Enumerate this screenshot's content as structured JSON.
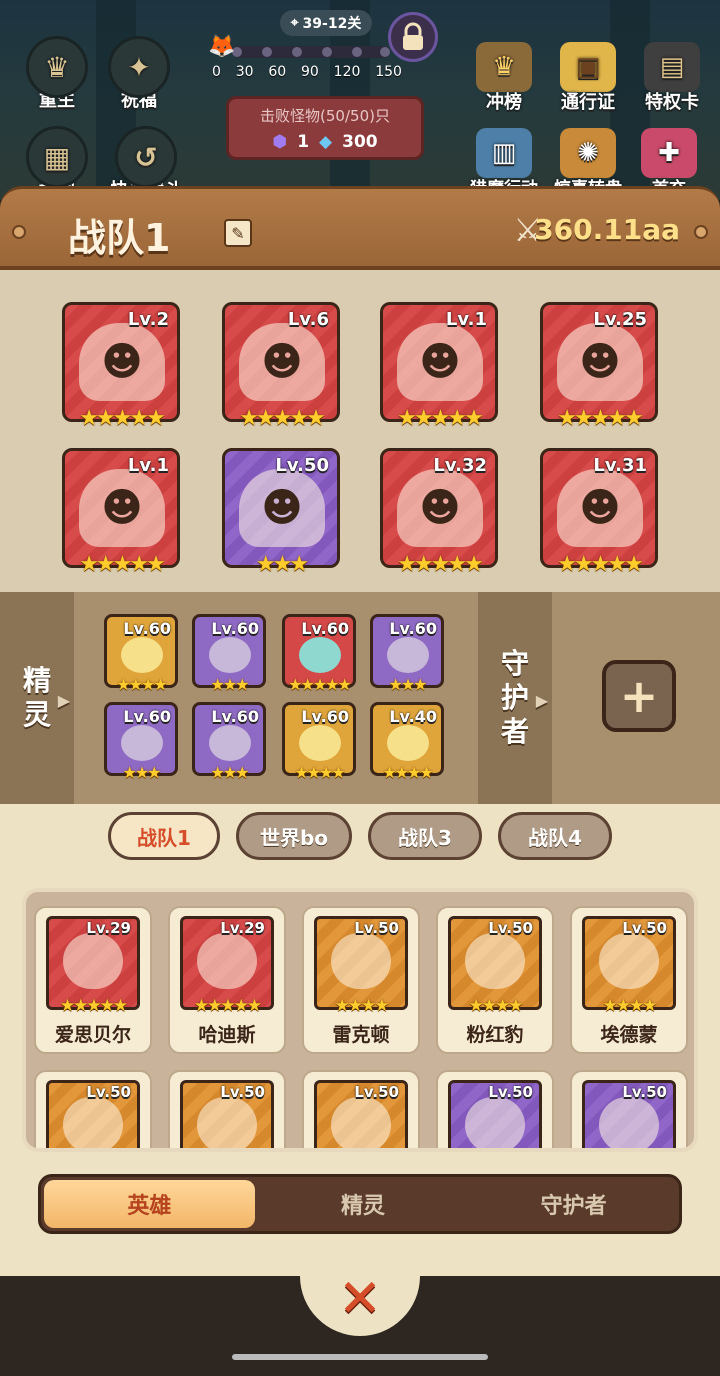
{
  "hud": {
    "stage": "39-12关",
    "progress_ticks": [
      "0",
      "30",
      "60",
      "90",
      "120",
      "150"
    ],
    "monster_label": "击败怪物(50/50)只",
    "monster_reward_gem": "1",
    "monster_reward_diamond": "300",
    "left_buttons": [
      "重生",
      "祝福",
      "地图",
      "快速战斗"
    ],
    "right_buttons": [
      "冲榜",
      "通行证",
      "特权卡"
    ],
    "bottom_right_buttons": [
      "猎魔行动",
      "惊喜转盘",
      "首充"
    ]
  },
  "team": {
    "title": "战队1",
    "power": "360.11aa"
  },
  "heroes": [
    {
      "lv": "Lv.2",
      "stars": "★★★★★",
      "color": "red"
    },
    {
      "lv": "Lv.6",
      "stars": "★★★★★",
      "color": "red"
    },
    {
      "lv": "Lv.1",
      "stars": "★★★★★",
      "color": "red"
    },
    {
      "lv": "Lv.25",
      "stars": "★★★★★",
      "color": "red"
    },
    {
      "lv": "Lv.1",
      "stars": "★★★★★",
      "color": "red"
    },
    {
      "lv": "Lv.50",
      "stars": "★★★",
      "color": "purple"
    },
    {
      "lv": "Lv.32",
      "stars": "★★★★★",
      "color": "red"
    },
    {
      "lv": "Lv.31",
      "stars": "★★★★★",
      "color": "red"
    }
  ],
  "spirit_tab": "精灵",
  "guardian_tab": "守护者",
  "spirits": [
    {
      "lv": "Lv.60",
      "stars": "★★★★",
      "color": "gold"
    },
    {
      "lv": "Lv.60",
      "stars": "★★★",
      "color": "purple"
    },
    {
      "lv": "Lv.60",
      "stars": "★★★★★",
      "color": "red"
    },
    {
      "lv": "Lv.60",
      "stars": "★★★",
      "color": "purple"
    },
    {
      "lv": "Lv.60",
      "stars": "★★★",
      "color": "purple"
    },
    {
      "lv": "Lv.60",
      "stars": "★★★",
      "color": "purple"
    },
    {
      "lv": "Lv.60",
      "stars": "★★★★",
      "color": "gold"
    },
    {
      "lv": "Lv.40",
      "stars": "★★★★",
      "color": "gold"
    }
  ],
  "team_tabs": [
    "战队1",
    "世界bo",
    "战队3",
    "战队4"
  ],
  "roster": [
    {
      "lv": "Lv.29",
      "stars": "★★★★★",
      "name": "爱思贝尔",
      "color": "red"
    },
    {
      "lv": "Lv.29",
      "stars": "★★★★★",
      "name": "哈迪斯",
      "color": "red"
    },
    {
      "lv": "Lv.50",
      "stars": "★★★★",
      "name": "雷克顿",
      "color": "orange"
    },
    {
      "lv": "Lv.50",
      "stars": "★★★★",
      "name": "粉红豹",
      "color": "orange"
    },
    {
      "lv": "Lv.50",
      "stars": "★★★★",
      "name": "埃德蒙",
      "color": "orange"
    },
    {
      "lv": "Lv.50",
      "stars": "",
      "name": "",
      "color": "orange"
    },
    {
      "lv": "Lv.50",
      "stars": "",
      "name": "",
      "color": "orange"
    },
    {
      "lv": "Lv.50",
      "stars": "",
      "name": "",
      "color": "orange"
    },
    {
      "lv": "Lv.50",
      "stars": "",
      "name": "",
      "color": "purple"
    },
    {
      "lv": "Lv.50",
      "stars": "",
      "name": "",
      "color": "purple"
    }
  ],
  "categories": [
    "英雄",
    "精灵",
    "守护者"
  ],
  "colors": {
    "accent": "#d64d2a",
    "wood": "#9b6638",
    "power_gold": "#ffe08a"
  }
}
